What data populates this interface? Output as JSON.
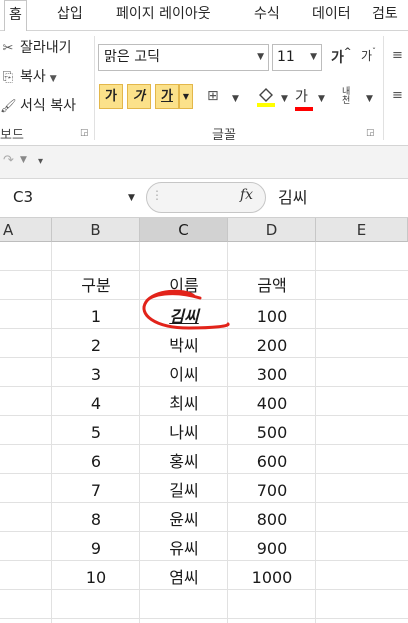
{
  "ribbon_tabs": [
    "홈",
    "삽입",
    "페이지 레이아웃",
    "수식",
    "데이터",
    "검토"
  ],
  "clipboard": {
    "cut": "잘라내기",
    "copy": "복사",
    "format_painter": "서식 복사",
    "group_label": "보드"
  },
  "font": {
    "name": "맑은 고딕",
    "size": "11",
    "bold": "가",
    "italic": "가",
    "underline": "가",
    "font_color_glyph": "가",
    "phonetic_glyph": "내천",
    "group_label": "글꼴"
  },
  "formula_bar": {
    "name_box": "C3",
    "fx": "fx",
    "content": "김씨"
  },
  "columns": [
    "A",
    "B",
    "C",
    "D",
    "E"
  ],
  "selected_column": "C",
  "table": {
    "headers": [
      "구분",
      "이름",
      "금액"
    ],
    "rows": [
      [
        "1",
        "김씨",
        "100"
      ],
      [
        "2",
        "박씨",
        "200"
      ],
      [
        "3",
        "이씨",
        "300"
      ],
      [
        "4",
        "최씨",
        "400"
      ],
      [
        "5",
        "나씨",
        "500"
      ],
      [
        "6",
        "홍씨",
        "600"
      ],
      [
        "7",
        "길씨",
        "700"
      ],
      [
        "8",
        "윤씨",
        "800"
      ],
      [
        "9",
        "유씨",
        "900"
      ],
      [
        "10",
        "염씨",
        "1000"
      ]
    ]
  },
  "colors": {
    "annotation": "#e2231a",
    "highlight_button": "#fbe18a",
    "selected_header": "#d2d2d2"
  }
}
